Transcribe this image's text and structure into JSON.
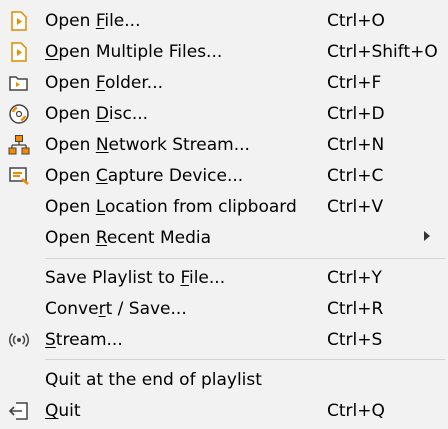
{
  "menu": {
    "items": [
      {
        "pre": "Open ",
        "u": "F",
        "post": "ile...",
        "shortcut": "Ctrl+O",
        "icon": "file-media-icon"
      },
      {
        "pre": "",
        "u": "O",
        "post": "pen Multiple Files...",
        "shortcut": "Ctrl+Shift+O",
        "icon": "files-media-icon"
      },
      {
        "pre": "Open ",
        "u": "F",
        "post": "older...",
        "shortcut": "Ctrl+F",
        "icon": "folder-icon"
      },
      {
        "pre": "Open ",
        "u": "D",
        "post": "isc...",
        "shortcut": "Ctrl+D",
        "icon": "disc-icon"
      },
      {
        "pre": "Open ",
        "u": "N",
        "post": "etwork Stream...",
        "shortcut": "Ctrl+N",
        "icon": "network-icon"
      },
      {
        "pre": "Open ",
        "u": "C",
        "post": "apture Device...",
        "shortcut": "Ctrl+C",
        "icon": "capture-device-icon"
      },
      {
        "pre": "Open ",
        "u": "L",
        "post": "ocation from clipboard",
        "shortcut": "Ctrl+V",
        "icon": ""
      },
      {
        "pre": "Open ",
        "u": "R",
        "post": "ecent Media",
        "shortcut": "",
        "icon": "",
        "submenu": true
      },
      {
        "pre": "Save Playlist to ",
        "u": "F",
        "post": "ile...",
        "shortcut": "Ctrl+Y",
        "icon": ""
      },
      {
        "pre": "Conve",
        "u": "r",
        "post": "t / Save...",
        "shortcut": "Ctrl+R",
        "icon": ""
      },
      {
        "pre": "",
        "u": "S",
        "post": "tream...",
        "shortcut": "Ctrl+S",
        "icon": "stream-icon"
      },
      {
        "pre": "Quit at the end of playlist",
        "u": "",
        "post": "",
        "shortcut": "",
        "icon": ""
      },
      {
        "pre": "",
        "u": "Q",
        "post": "uit",
        "shortcut": "Ctrl+Q",
        "icon": "quit-icon"
      }
    ]
  },
  "colors": {
    "background": "#f2f2f2",
    "separator": "#d4d4d4",
    "vlc_orange": "#f28b00"
  }
}
